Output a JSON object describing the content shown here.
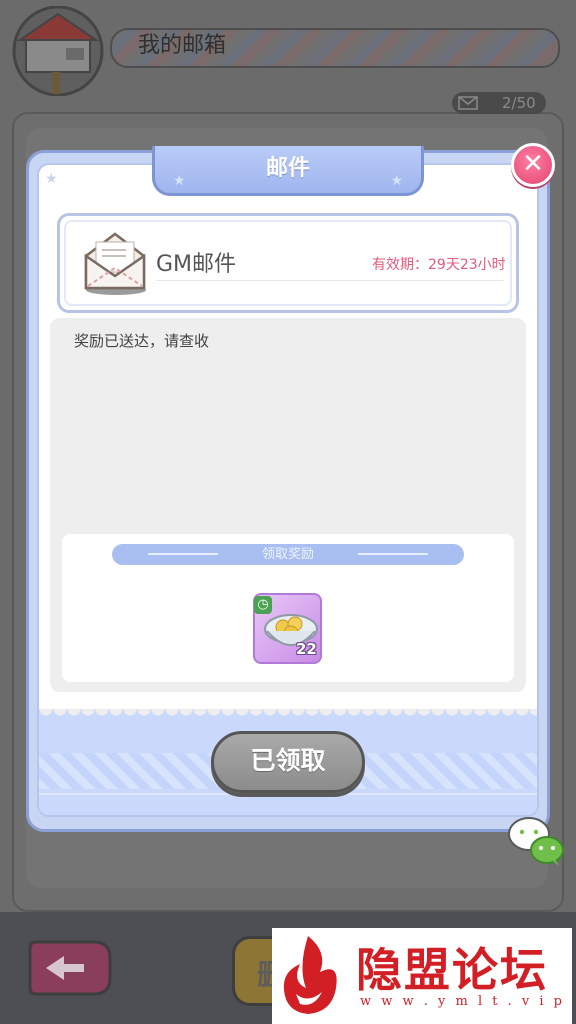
{
  "background_screen": {
    "title": "我的邮箱",
    "mail_count": "2/50",
    "bottom_button_partial": "删"
  },
  "dialog": {
    "title": "邮件",
    "mail": {
      "sender": "GM邮件",
      "expiry": "有效期：29天23小时",
      "body": "奖励已送达，请查收"
    },
    "reward_section": {
      "label": "领取奖励",
      "items": [
        {
          "icon": "tangyuan-bowl-icon",
          "count": "22",
          "badge": "clock-icon"
        }
      ]
    },
    "claim_button_label": "已领取"
  },
  "watermark": {
    "title": "隐盟论坛",
    "url": "w w w . y m l t . v i p"
  },
  "colors": {
    "dialog_border": "#8aa0d6",
    "title_tab": "#9fb5ee",
    "close_button": "#e2446f",
    "expiry_text": "#e65a7a",
    "claimed_button": "#8c8c8c",
    "watermark": "#d21f25"
  }
}
